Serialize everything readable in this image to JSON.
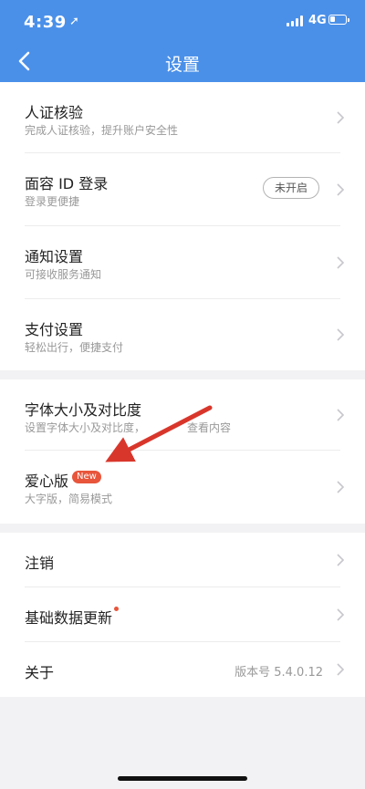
{
  "status_bar": {
    "time": "4:39",
    "network": "4G"
  },
  "header": {
    "title": "设置",
    "back_icon": "chevron-left-icon"
  },
  "group1": [
    {
      "title": "人证核验",
      "subtitle": "完成人证核验，提升账户安全性"
    },
    {
      "title": "面容 ID 登录",
      "subtitle": "登录更便捷",
      "toggle_label": "未开启"
    },
    {
      "title": "通知设置",
      "subtitle": "可接收服务通知"
    },
    {
      "title": "支付设置",
      "subtitle": "轻松出行，便捷支付"
    }
  ],
  "group2": [
    {
      "title": "字体大小及对比度",
      "subtitle_visible": "设置字体大小及对比度，",
      "subtitle_tail": "查看内容"
    },
    {
      "title": "爱心版",
      "badge": "New",
      "subtitle": "大字版，简易模式"
    }
  ],
  "group3": [
    {
      "title": "注销"
    },
    {
      "title": "基础数据更新"
    },
    {
      "title": "关于",
      "value": "版本号 5.4.0.12"
    }
  ],
  "colors": {
    "header": "#4a90e9",
    "badge": "#e8553b",
    "annotation_arrow": "#d9362b"
  }
}
